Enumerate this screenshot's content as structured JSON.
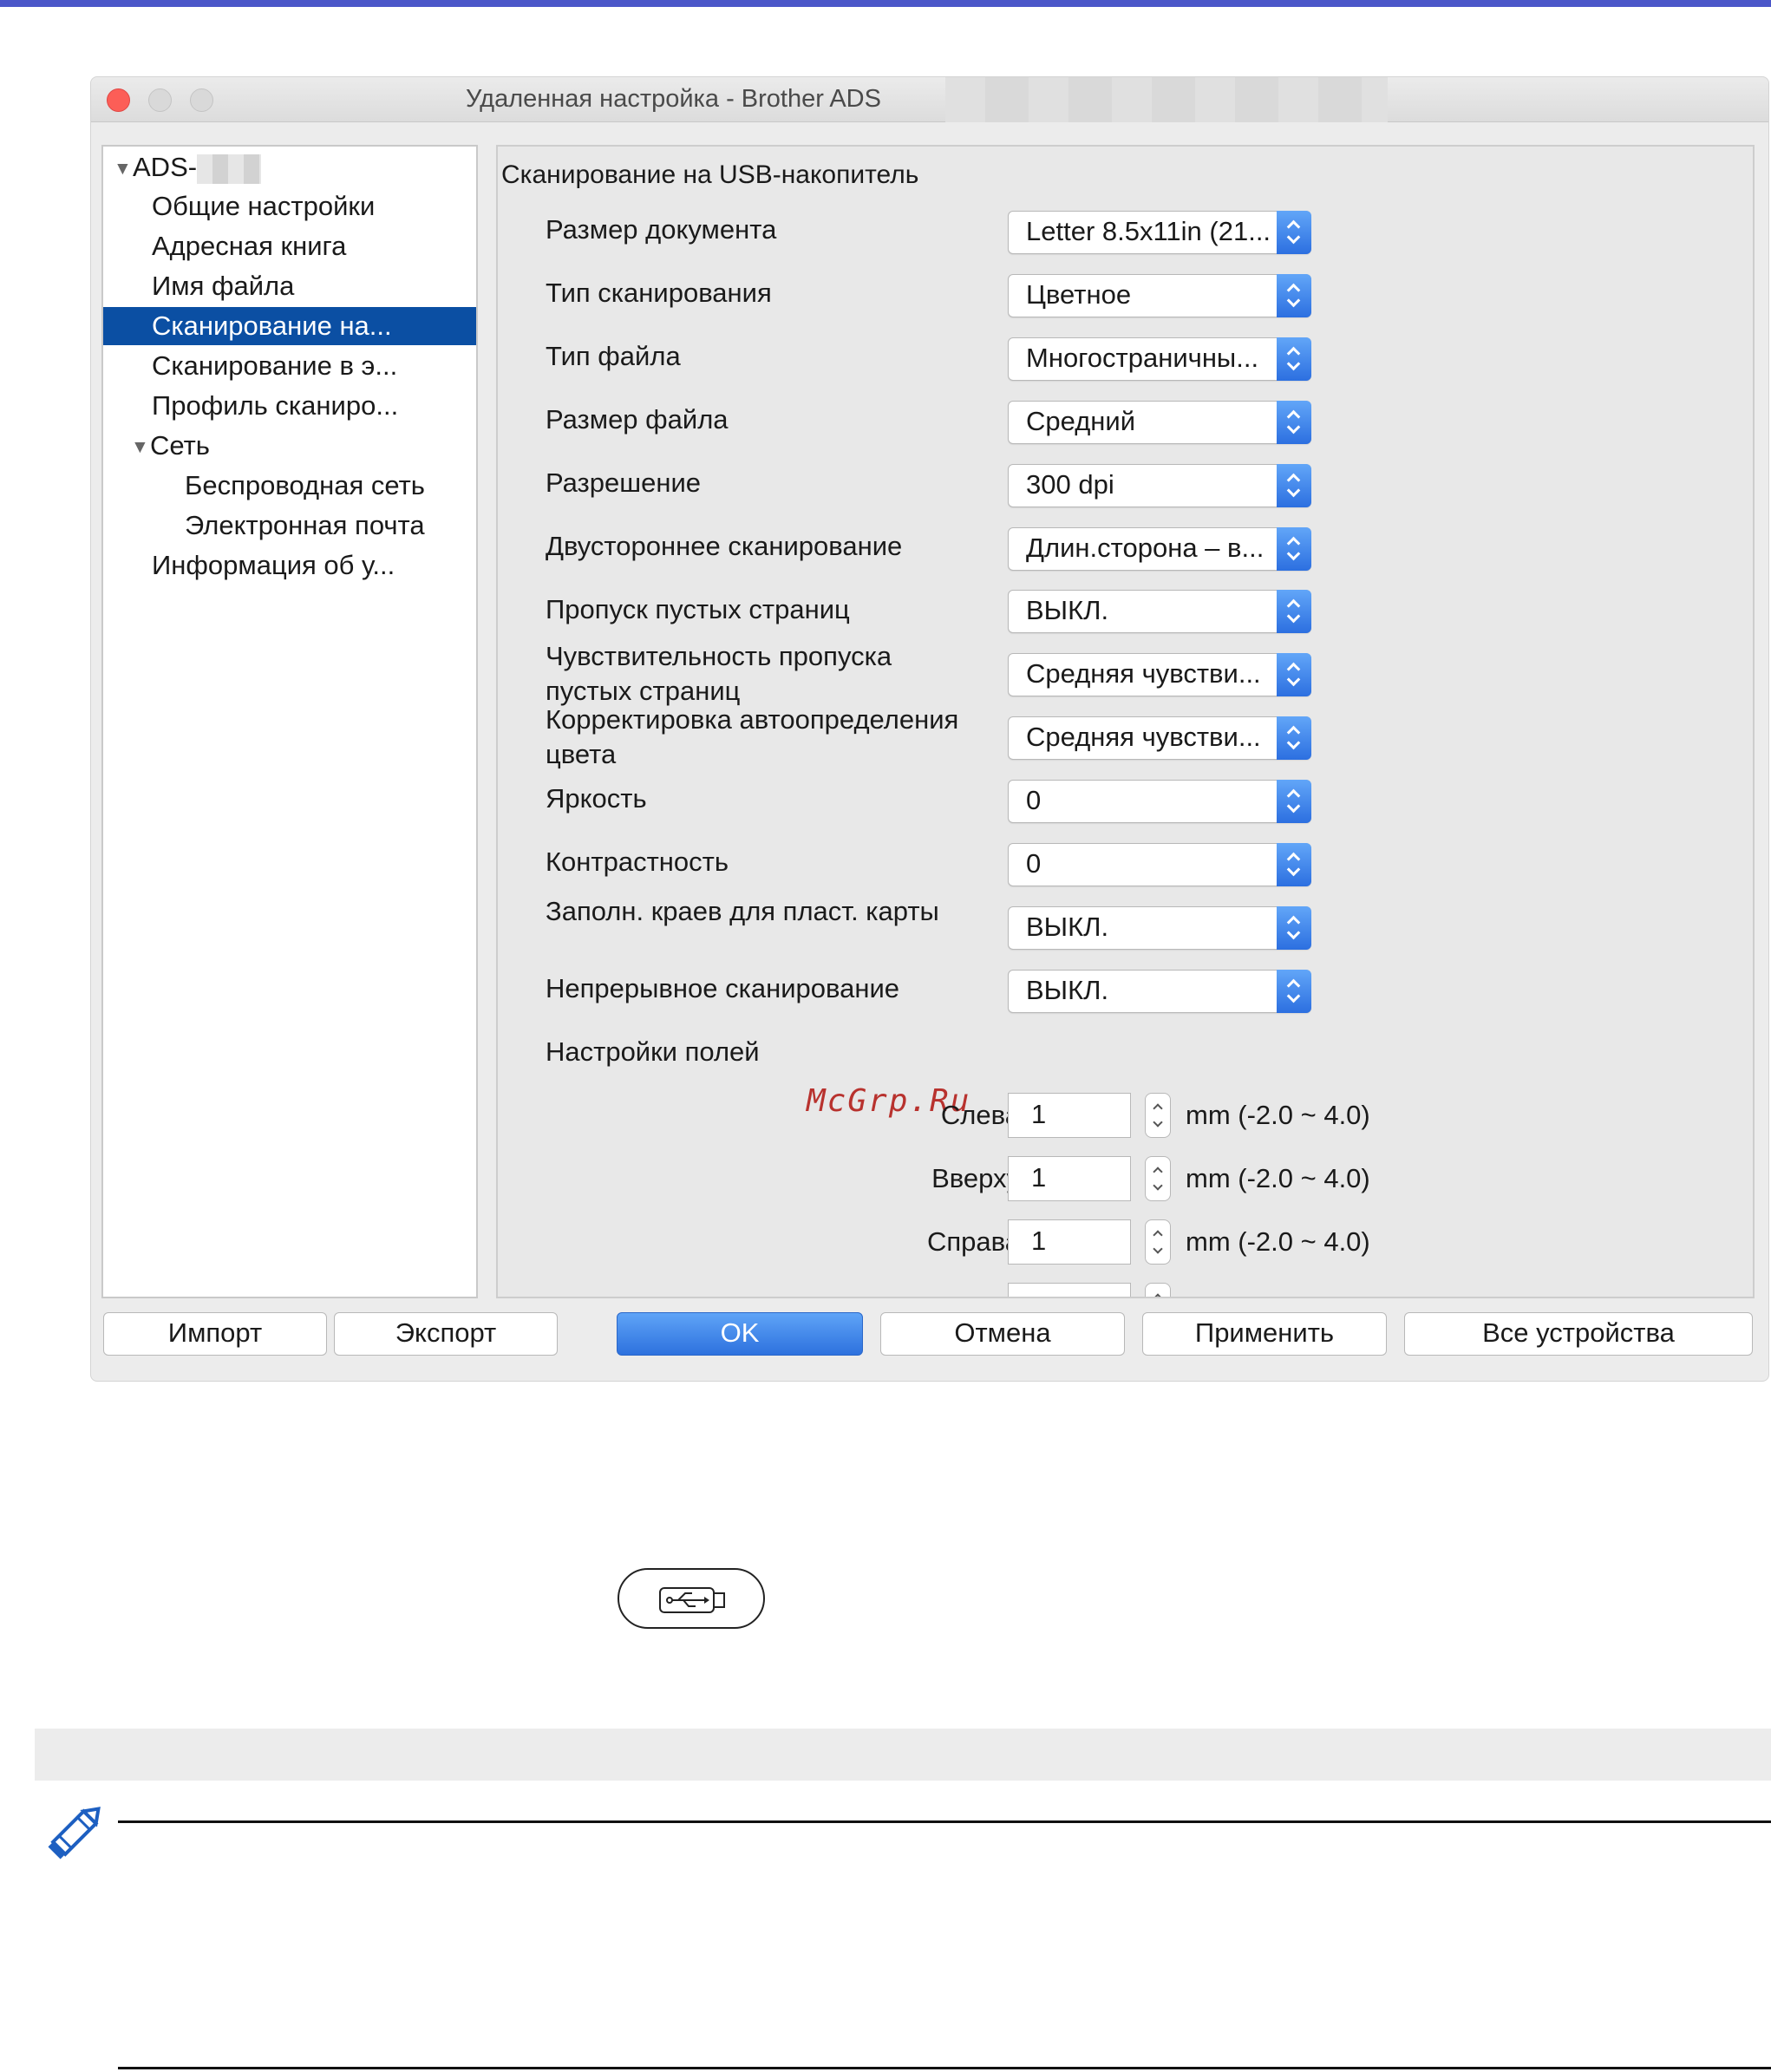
{
  "window": {
    "title": "Удаленная настройка - Brother ADS"
  },
  "tree": {
    "root_label": "ADS-",
    "items": [
      {
        "label": "Общие настройки"
      },
      {
        "label": "Адресная книга"
      },
      {
        "label": "Имя файла"
      },
      {
        "label": "Сканирование на..."
      },
      {
        "label": "Сканирование в э..."
      },
      {
        "label": "Профиль сканиро..."
      },
      {
        "label": "Сеть"
      },
      {
        "label": "Беспроводная сеть"
      },
      {
        "label": "Электронная почта"
      },
      {
        "label": "Информация об у..."
      }
    ],
    "selected_index": 3
  },
  "panel": {
    "title": "Сканирование на USB-накопитель",
    "settings": [
      {
        "label": "Размер документа",
        "value": "Letter 8.5x11in (21..."
      },
      {
        "label": "Тип сканирования",
        "value": "Цветное"
      },
      {
        "label": "Тип файла",
        "value": "Многостраничны..."
      },
      {
        "label": "Размер файла",
        "value": "Средний"
      },
      {
        "label": "Разрешение",
        "value": "300 dpi"
      },
      {
        "label": "Двустороннее сканирование",
        "value": "Длин.сторона – в..."
      },
      {
        "label": "Пропуск пустых страниц",
        "value": "ВЫКЛ."
      },
      {
        "label_line1": "Чувствительность пропуска",
        "label_line2": "пустых страниц",
        "value": "Средняя чувстви..."
      },
      {
        "label_line1": "Корректировка автоопределения",
        "label_line2": "цвета",
        "value": "Средняя чувстви..."
      },
      {
        "label": "Яркость",
        "value": "0"
      },
      {
        "label": "Контрастность",
        "value": "0"
      },
      {
        "label": "Заполн. краев для пласт. карты",
        "value": "ВЫКЛ."
      },
      {
        "label": "Непрерывное сканирование",
        "value": "ВЫКЛ."
      }
    ],
    "margins_label": "Настройки полей",
    "margins": [
      {
        "label": "Слева",
        "value": "1",
        "unit": "mm (-2.0 ~ 4.0)"
      },
      {
        "label": "Вверху",
        "value": "1",
        "unit": "mm (-2.0 ~ 4.0)"
      },
      {
        "label": "Справа",
        "value": "1",
        "unit": "mm (-2.0 ~ 4.0)"
      }
    ]
  },
  "watermark": "McGrp.Ru",
  "buttons": {
    "import": "Импорт",
    "export": "Экспорт",
    "ok": "OK",
    "cancel": "Отмена",
    "apply": "Применить",
    "all_devices": "Все устройства"
  },
  "icons": {
    "usb": "usb-icon",
    "note": "pencil-icon"
  },
  "colors": {
    "accent": "#4b57c9",
    "selection": "#0b4fa3",
    "primary_button": "#2d71de",
    "close_button": "#fc5e57"
  }
}
